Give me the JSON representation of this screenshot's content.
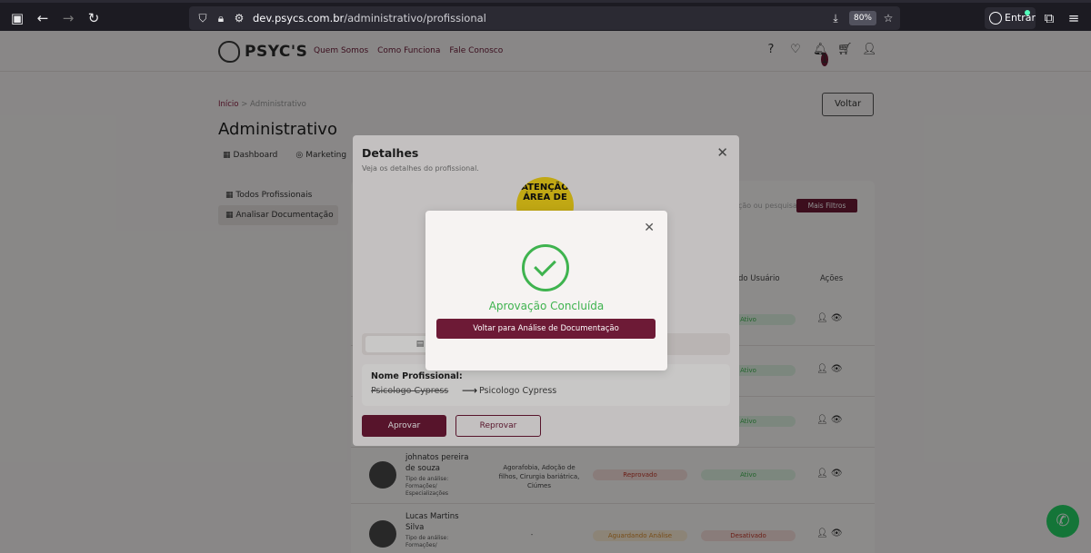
{
  "browser": {
    "url_host": "dev.psycs.com.br",
    "url_path": "/administrativo/profissional",
    "zoom": "80%",
    "signin_label": "Entrar"
  },
  "site": {
    "logo_text": "PSYC'S",
    "nav": [
      "Quem Somos",
      "Como Funciona",
      "Fale Conosco"
    ],
    "cart_badge": "1"
  },
  "page": {
    "breadcrumb_home": "Início",
    "breadcrumb_sep": " > ",
    "breadcrumb_current": "Administrativo",
    "title": "Administrativo",
    "back_button": "Voltar",
    "tabs": [
      "Dashboard",
      "Marketing"
    ],
    "sidebar": [
      "Todos Profissionais",
      "Analisar Documentação"
    ],
    "filter_placeholder": "ção ou pesquisa",
    "more_filters": "Mais Filtros",
    "columns": {
      "user_status": "do Usuário",
      "actions": "Ações"
    },
    "rows": [
      {
        "name": "johnatos pereira de souza",
        "sub": "Tipo de análise: Formações/ Especializações",
        "areas": "Agorafobia, Adoção de filhos, Cirurgia bariátrica, Ciúmes",
        "status": "Reprovado",
        "user_status": "Ativo"
      },
      {
        "name": "Lucas Martins Silva",
        "sub": "Tipo de análise: Formações/",
        "areas": "-",
        "status": "Aguardando Análise",
        "user_status": "Desativado"
      }
    ],
    "partial_status_labels": [
      "Ativo",
      "Ativo",
      "Ativo"
    ]
  },
  "details_modal": {
    "title": "Detalhes",
    "subtitle": "Veja os detalhes do profissional.",
    "photo_text": "ATENÇÃO ÁREA DE",
    "field_label": "Nome Profissional:",
    "old_value": "Psicologo Cypress",
    "new_value": "Psicologo Cypress",
    "approve_button": "Aprovar",
    "reject_button": "Reprovar"
  },
  "success_modal": {
    "title": "Aprovação Concluída",
    "button": "Voltar para Análise de Documentação"
  },
  "colors": {
    "brand": "#6d1a36",
    "success": "#3fb34f",
    "whatsapp": "#25d366"
  }
}
